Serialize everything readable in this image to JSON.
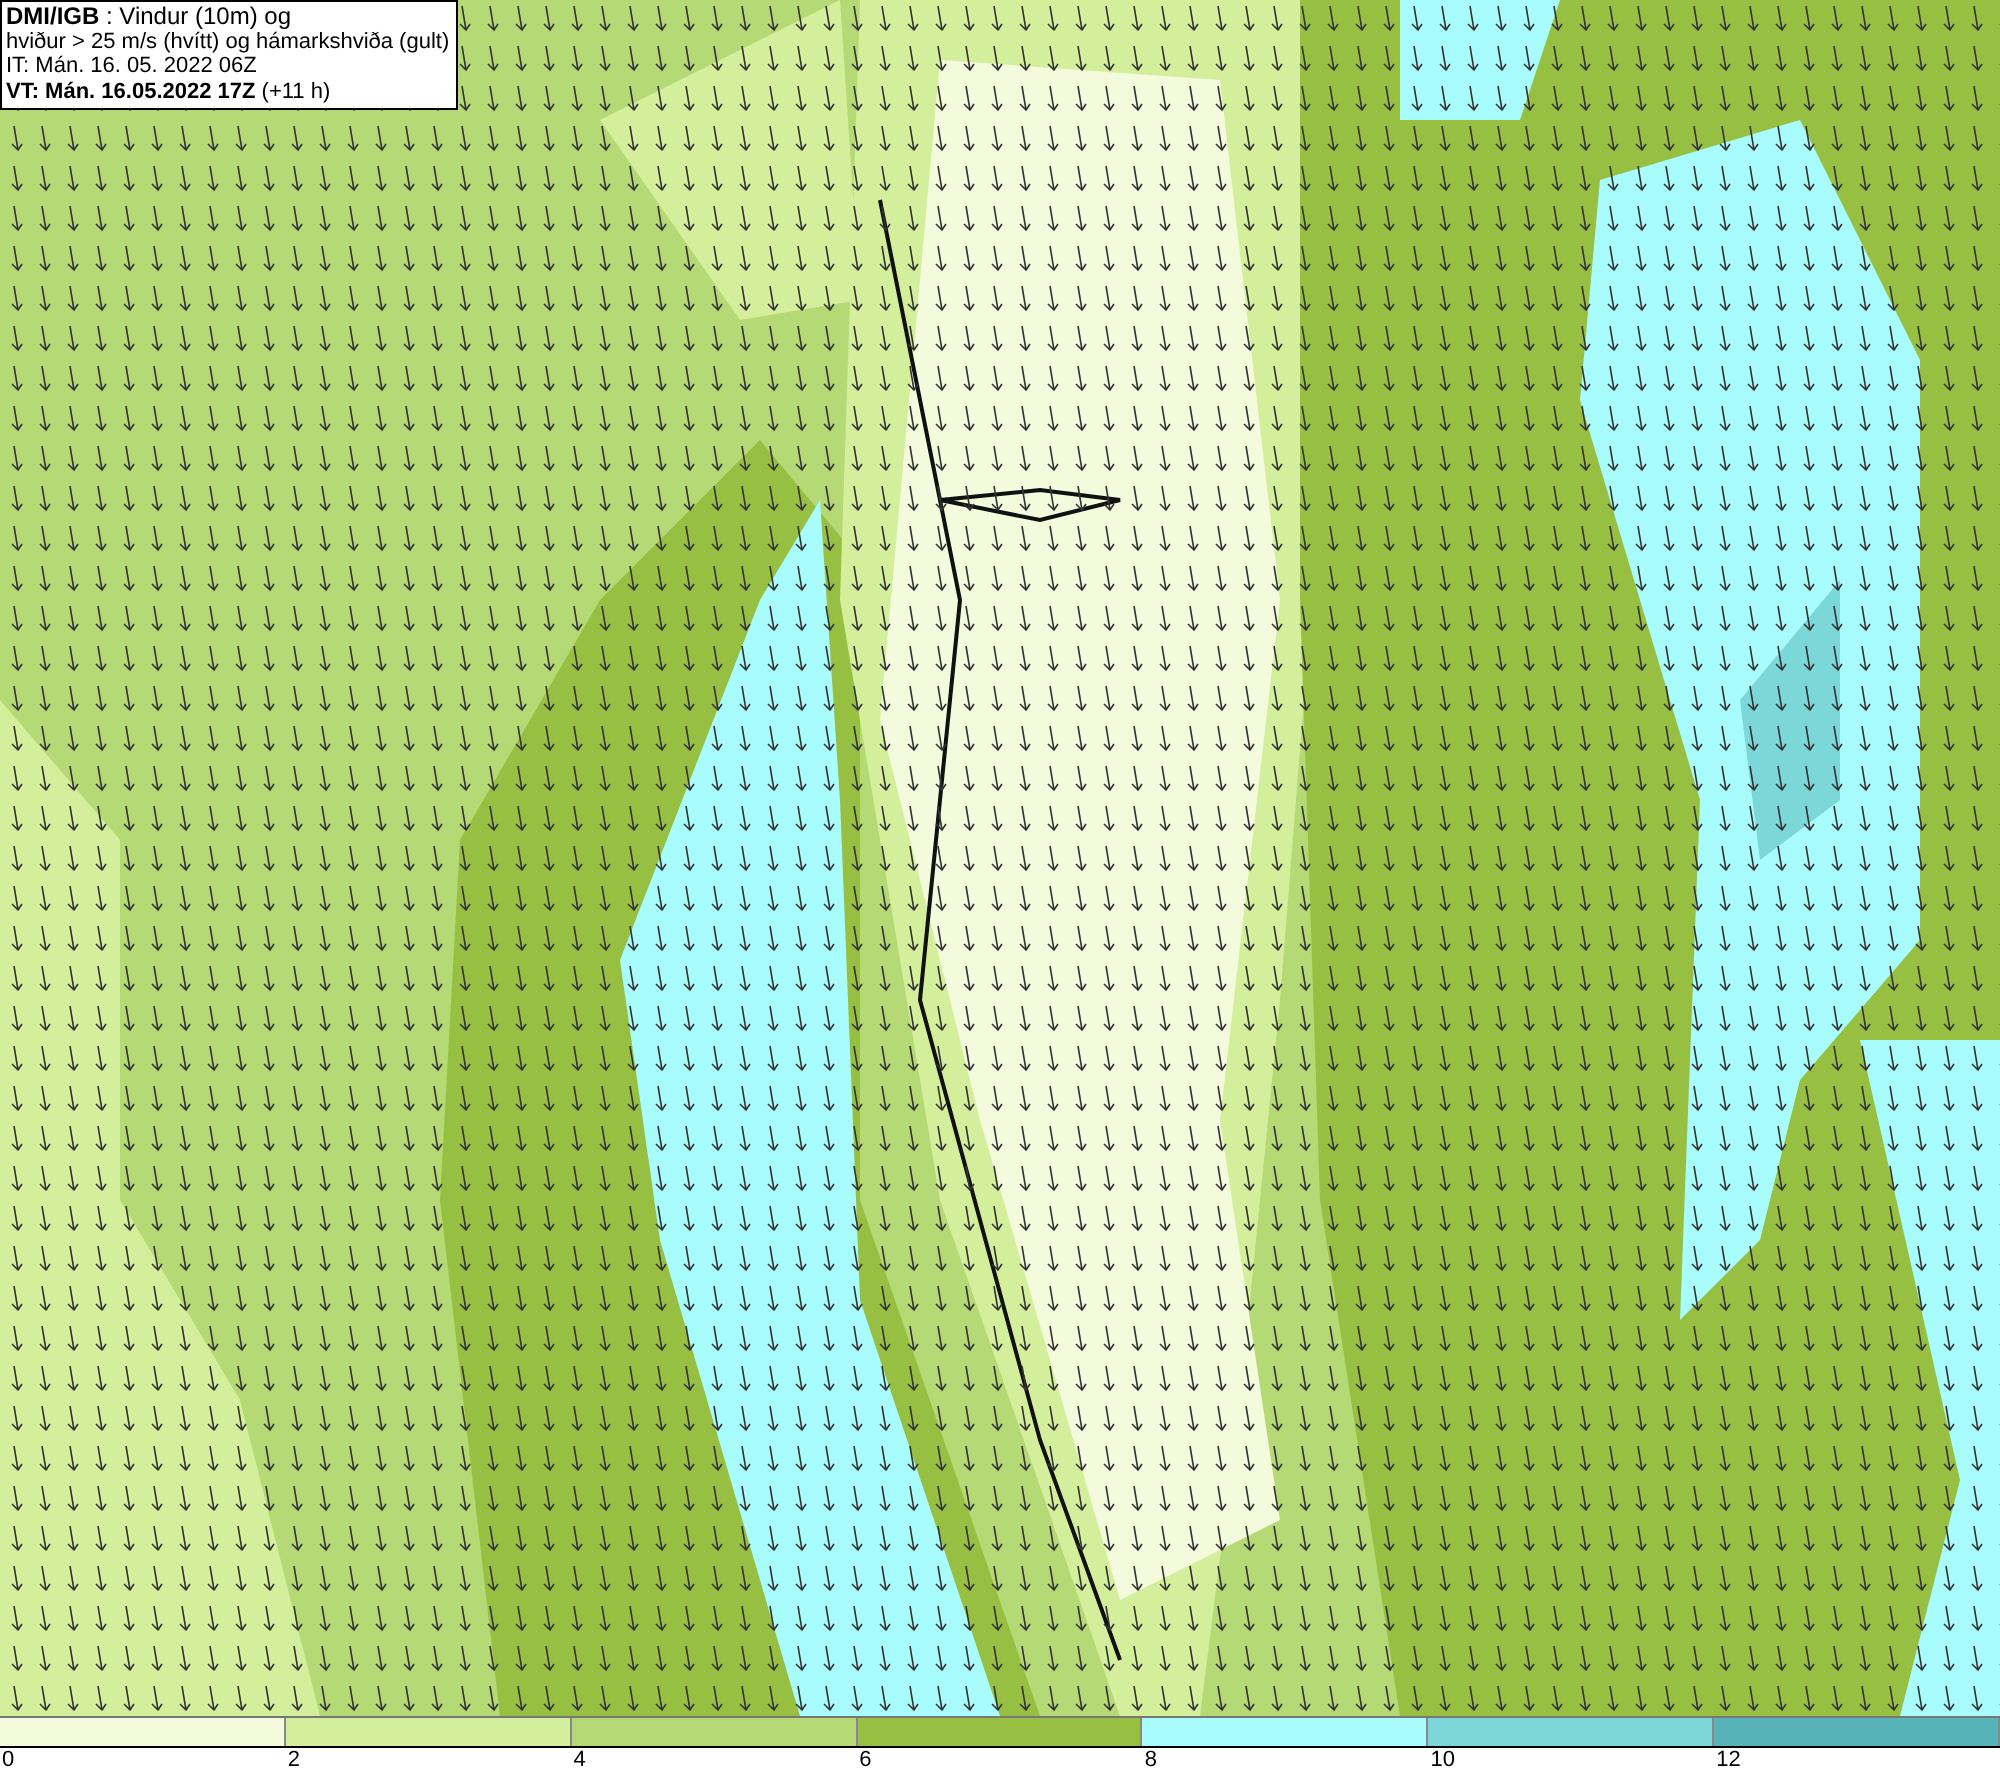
{
  "info_box": {
    "lines": [
      "**DMI/IGB** : Vindur (10m) og",
      "hviður > 25 m/s (hvítt) og hámarkshviða (gult)",
      "IT: Mán. 16. 05. 2022 06Z",
      "**VT: Mán. 16.05.2022 17Z** (+11 h)"
    ]
  },
  "legend": {
    "segments": [
      {
        "color": "#f4fadc"
      },
      {
        "color": "#d4ef9c"
      },
      {
        "color": "#b5d974"
      },
      {
        "color": "#97c043"
      },
      {
        "color": "#a8fcfc"
      },
      {
        "color": "#7cd8d8"
      },
      {
        "color": "#56b4b8"
      }
    ],
    "ticks": [
      "0",
      "2",
      "4",
      "6",
      "8",
      "10",
      "12"
    ]
  }
}
